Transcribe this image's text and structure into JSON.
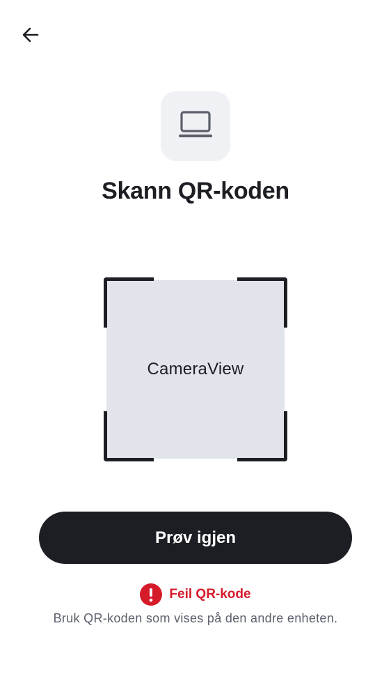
{
  "header": {
    "back_icon": "arrow-left-icon"
  },
  "device": {
    "icon": "laptop-icon"
  },
  "title": "Skann QR-koden",
  "scanner": {
    "camera_label": "CameraView"
  },
  "actions": {
    "retry_label": "Prøv igjen"
  },
  "error": {
    "icon": "exclamation-circle-icon",
    "message": "Feil QR-kode",
    "hint": "Bruk QR-koden som vises på den andre enheten."
  },
  "colors": {
    "primary": "#1c1e24",
    "error": "#d51a2a",
    "camera_background": "#e1e5eb",
    "icon_tile": "#f0f1f5",
    "hint_text": "#5a5f6b"
  }
}
